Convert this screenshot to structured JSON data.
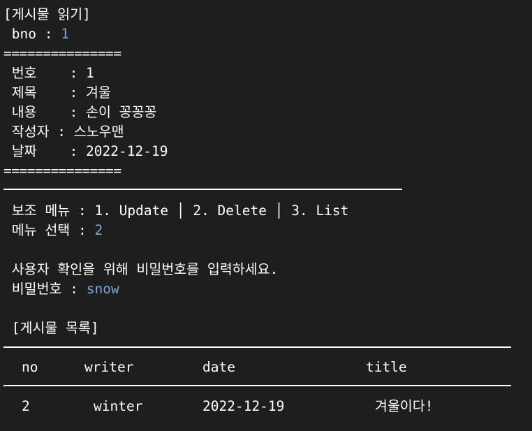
{
  "read_section": {
    "header": "[게시물 읽기]",
    "bno_prompt": " bno : ",
    "bno_value": "1",
    "separator_top": "===============",
    "fields": [
      " 번호    : 1",
      " 제목    : 겨울",
      " 내용    : 손이 꽁꽁꽁",
      " 작성자 : 스노우맨",
      " 날짜    : 2022-12-19"
    ],
    "separator_bottom": "==============="
  },
  "menu_section": {
    "sub_menu": " 보조 메뉴 : 1. Update │ 2. Delete │ 3. List",
    "select_prompt": " 메뉴 선택 : ",
    "select_value": "2"
  },
  "auth_section": {
    "message": " 사용자 확인을 위해 비밀번호를 입력하세요.",
    "password_prompt": " 비밀번호 : ",
    "password_value": "snow"
  },
  "list_section": {
    "header": " [게시물 목록]",
    "columns": [
      "no",
      "writer",
      "date",
      "title"
    ],
    "rows": [
      {
        "no": "2",
        "writer": "winter",
        "date": "2022-12-19",
        "title": "겨울이다!"
      }
    ]
  }
}
